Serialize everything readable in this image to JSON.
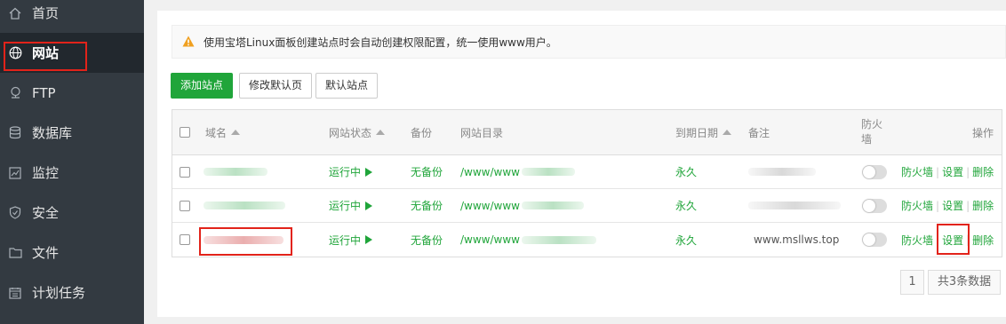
{
  "sidebar": {
    "items": [
      {
        "label": "首页",
        "icon": "home-icon"
      },
      {
        "label": "网站",
        "icon": "globe-icon"
      },
      {
        "label": "FTP",
        "icon": "ftp-icon"
      },
      {
        "label": "数据库",
        "icon": "database-icon"
      },
      {
        "label": "监控",
        "icon": "monitor-icon"
      },
      {
        "label": "安全",
        "icon": "shield-icon"
      },
      {
        "label": "文件",
        "icon": "folder-icon"
      },
      {
        "label": "计划任务",
        "icon": "calendar-icon"
      }
    ]
  },
  "notice": "使用宝塔Linux面板创建站点时会自动创建权限配置，统一使用www用户。",
  "toolbar": {
    "add_site": "添加站点",
    "edit_default_page": "修改默认页",
    "default_site": "默认站点"
  },
  "table": {
    "headers": {
      "domain": "域名",
      "status": "网站状态",
      "backup": "备份",
      "dir": "网站目录",
      "expire": "到期日期",
      "note": "备注",
      "firewall": "防火墙",
      "ops": "操作"
    },
    "rows": [
      {
        "status": "运行中",
        "backup": "无备份",
        "dir": "/www/www",
        "expire": "永久",
        "note": "",
        "ops": [
          "防火墙",
          "设置",
          "删除"
        ]
      },
      {
        "status": "运行中",
        "backup": "无备份",
        "dir": "/www/www",
        "expire": "永久",
        "note": "",
        "ops": [
          "防火墙",
          "设置",
          "删除"
        ]
      },
      {
        "status": "运行中",
        "backup": "无备份",
        "dir": "/www/www",
        "expire": "永久",
        "note": "www.msllws.top",
        "ops": [
          "防火墙",
          "设置",
          "删除"
        ]
      }
    ]
  },
  "pagination": {
    "page": "1",
    "total": "共3条数据"
  },
  "colors": {
    "sidebar_bg": "#333a41",
    "accent_green": "#20a53a",
    "highlight_red": "#e2231a"
  }
}
